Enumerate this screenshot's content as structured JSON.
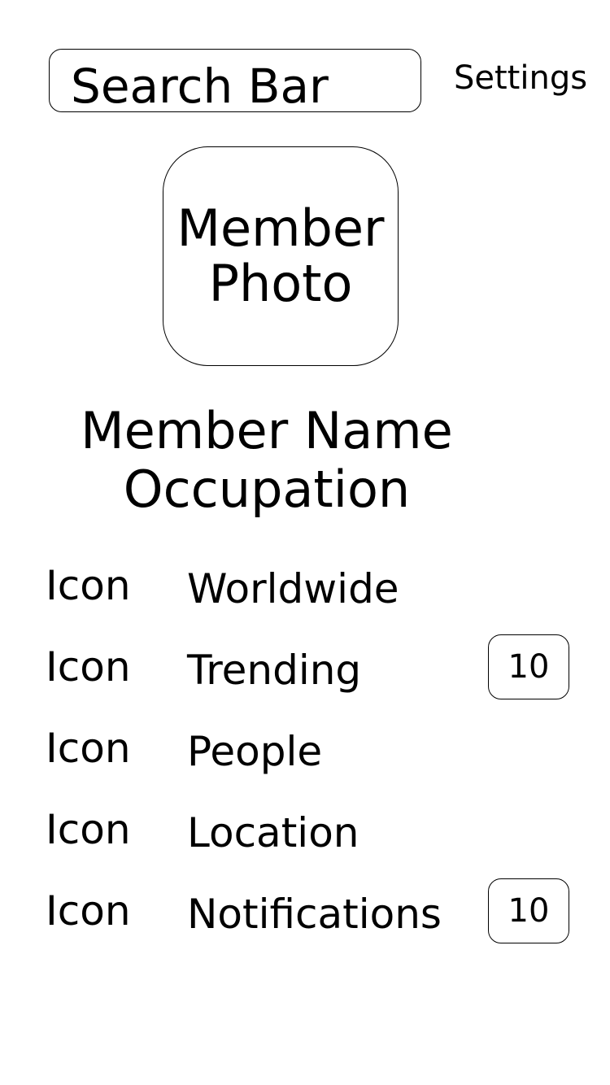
{
  "header": {
    "search_label": "Search Bar",
    "settings_label": "Settings"
  },
  "profile": {
    "photo_label": "Member\nPhoto",
    "name": "Member Name",
    "occupation": "Occupation"
  },
  "nav": {
    "items": [
      {
        "icon_label": "Icon",
        "label": "Worldwide",
        "badge": null
      },
      {
        "icon_label": "Icon",
        "label": "Trending",
        "badge": "10"
      },
      {
        "icon_label": "Icon",
        "label": "People",
        "badge": null
      },
      {
        "icon_label": "Icon",
        "label": "Location",
        "badge": null
      },
      {
        "icon_label": "Icon",
        "label": "Notifications",
        "badge": "10"
      }
    ]
  }
}
